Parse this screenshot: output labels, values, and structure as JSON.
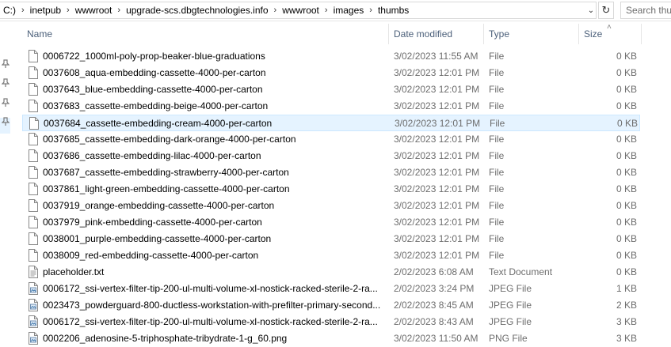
{
  "address": {
    "crumbs": [
      "C:)",
      "inetpub",
      "wwwroot",
      "upgrade-scs.dbgtechnologies.info",
      "wwwroot",
      "images",
      "thumbs"
    ],
    "separator": "›",
    "dropdown_icon": "chevron-down-icon",
    "refresh_icon": "refresh-icon",
    "refresh_glyph": "↻",
    "dropdown_glyph": "⌄",
    "search_placeholder": "Search thumbs"
  },
  "columns": {
    "name": "Name",
    "date": "Date modified",
    "type": "Type",
    "size": "Size",
    "sort_glyph": "˄"
  },
  "files": [
    {
      "name": "0006722_1000ml-poly-prop-beaker-blue-graduations",
      "date": "3/02/2023 11:55 AM",
      "type": "File",
      "size": "0 KB",
      "icon": "blank-file-icon"
    },
    {
      "name": "0037608_aqua-embedding-cassette-4000-per-carton",
      "date": "3/02/2023 12:01 PM",
      "type": "File",
      "size": "0 KB",
      "icon": "blank-file-icon"
    },
    {
      "name": "0037643_blue-embedding-cassette-4000-per-carton",
      "date": "3/02/2023 12:01 PM",
      "type": "File",
      "size": "0 KB",
      "icon": "blank-file-icon"
    },
    {
      "name": "0037683_cassette-embedding-beige-4000-per-carton",
      "date": "3/02/2023 12:01 PM",
      "type": "File",
      "size": "0 KB",
      "icon": "blank-file-icon"
    },
    {
      "name": "0037684_cassette-embedding-cream-4000-per-carton",
      "date": "3/02/2023 12:01 PM",
      "type": "File",
      "size": "0 KB",
      "icon": "blank-file-icon",
      "selected": true
    },
    {
      "name": "0037685_cassette-embedding-dark-orange-4000-per-carton",
      "date": "3/02/2023 12:01 PM",
      "type": "File",
      "size": "0 KB",
      "icon": "blank-file-icon"
    },
    {
      "name": "0037686_cassette-embedding-lilac-4000-per-carton",
      "date": "3/02/2023 12:01 PM",
      "type": "File",
      "size": "0 KB",
      "icon": "blank-file-icon"
    },
    {
      "name": "0037687_cassette-embedding-strawberry-4000-per-carton",
      "date": "3/02/2023 12:01 PM",
      "type": "File",
      "size": "0 KB",
      "icon": "blank-file-icon"
    },
    {
      "name": "0037861_light-green-embedding-cassette-4000-per-carton",
      "date": "3/02/2023 12:01 PM",
      "type": "File",
      "size": "0 KB",
      "icon": "blank-file-icon"
    },
    {
      "name": "0037919_orange-embedding-cassette-4000-per-carton",
      "date": "3/02/2023 12:01 PM",
      "type": "File",
      "size": "0 KB",
      "icon": "blank-file-icon"
    },
    {
      "name": "0037979_pink-embedding-cassette-4000-per-carton",
      "date": "3/02/2023 12:01 PM",
      "type": "File",
      "size": "0 KB",
      "icon": "blank-file-icon"
    },
    {
      "name": "0038001_purple-embedding-cassette-4000-per-carton",
      "date": "3/02/2023 12:01 PM",
      "type": "File",
      "size": "0 KB",
      "icon": "blank-file-icon"
    },
    {
      "name": "0038009_red-embedding-cassette-4000-per-carton",
      "date": "3/02/2023 12:01 PM",
      "type": "File",
      "size": "0 KB",
      "icon": "blank-file-icon"
    },
    {
      "name": "placeholder.txt",
      "date": "2/02/2023 6:08 AM",
      "type": "Text Document",
      "size": "0 KB",
      "icon": "text-file-icon"
    },
    {
      "name": "0006172_ssi-vertex-filter-tip-200-ul-multi-volume-xl-nostick-racked-sterile-2-ra...",
      "date": "2/02/2023 3:24 PM",
      "type": "JPEG File",
      "size": "1 KB",
      "icon": "image-file-icon"
    },
    {
      "name": "0023473_powderguard-800-ductless-workstation-with-prefilter-primary-second...",
      "date": "2/02/2023 8:45 AM",
      "type": "JPEG File",
      "size": "2 KB",
      "icon": "image-file-icon"
    },
    {
      "name": "0006172_ssi-vertex-filter-tip-200-ul-multi-volume-xl-nostick-racked-sterile-2-ra...",
      "date": "2/02/2023 8:43 AM",
      "type": "JPEG File",
      "size": "3 KB",
      "icon": "image-file-icon"
    },
    {
      "name": "0002206_adenosine-5-triphosphate-tribydrate-1-g_60.png",
      "date": "3/02/2023 11:50 AM",
      "type": "PNG File",
      "size": "3 KB",
      "icon": "image-file-icon"
    }
  ],
  "nav": {
    "pins": [
      "pin-icon",
      "pin-icon",
      "pin-icon",
      "pin-icon"
    ],
    "pin_glyph": "📌"
  },
  "colors": {
    "selection_bg": "#e5f3ff",
    "selection_border": "#cce8ff",
    "header_text": "#4c607a",
    "secondary_text": "#6d6d6d"
  }
}
